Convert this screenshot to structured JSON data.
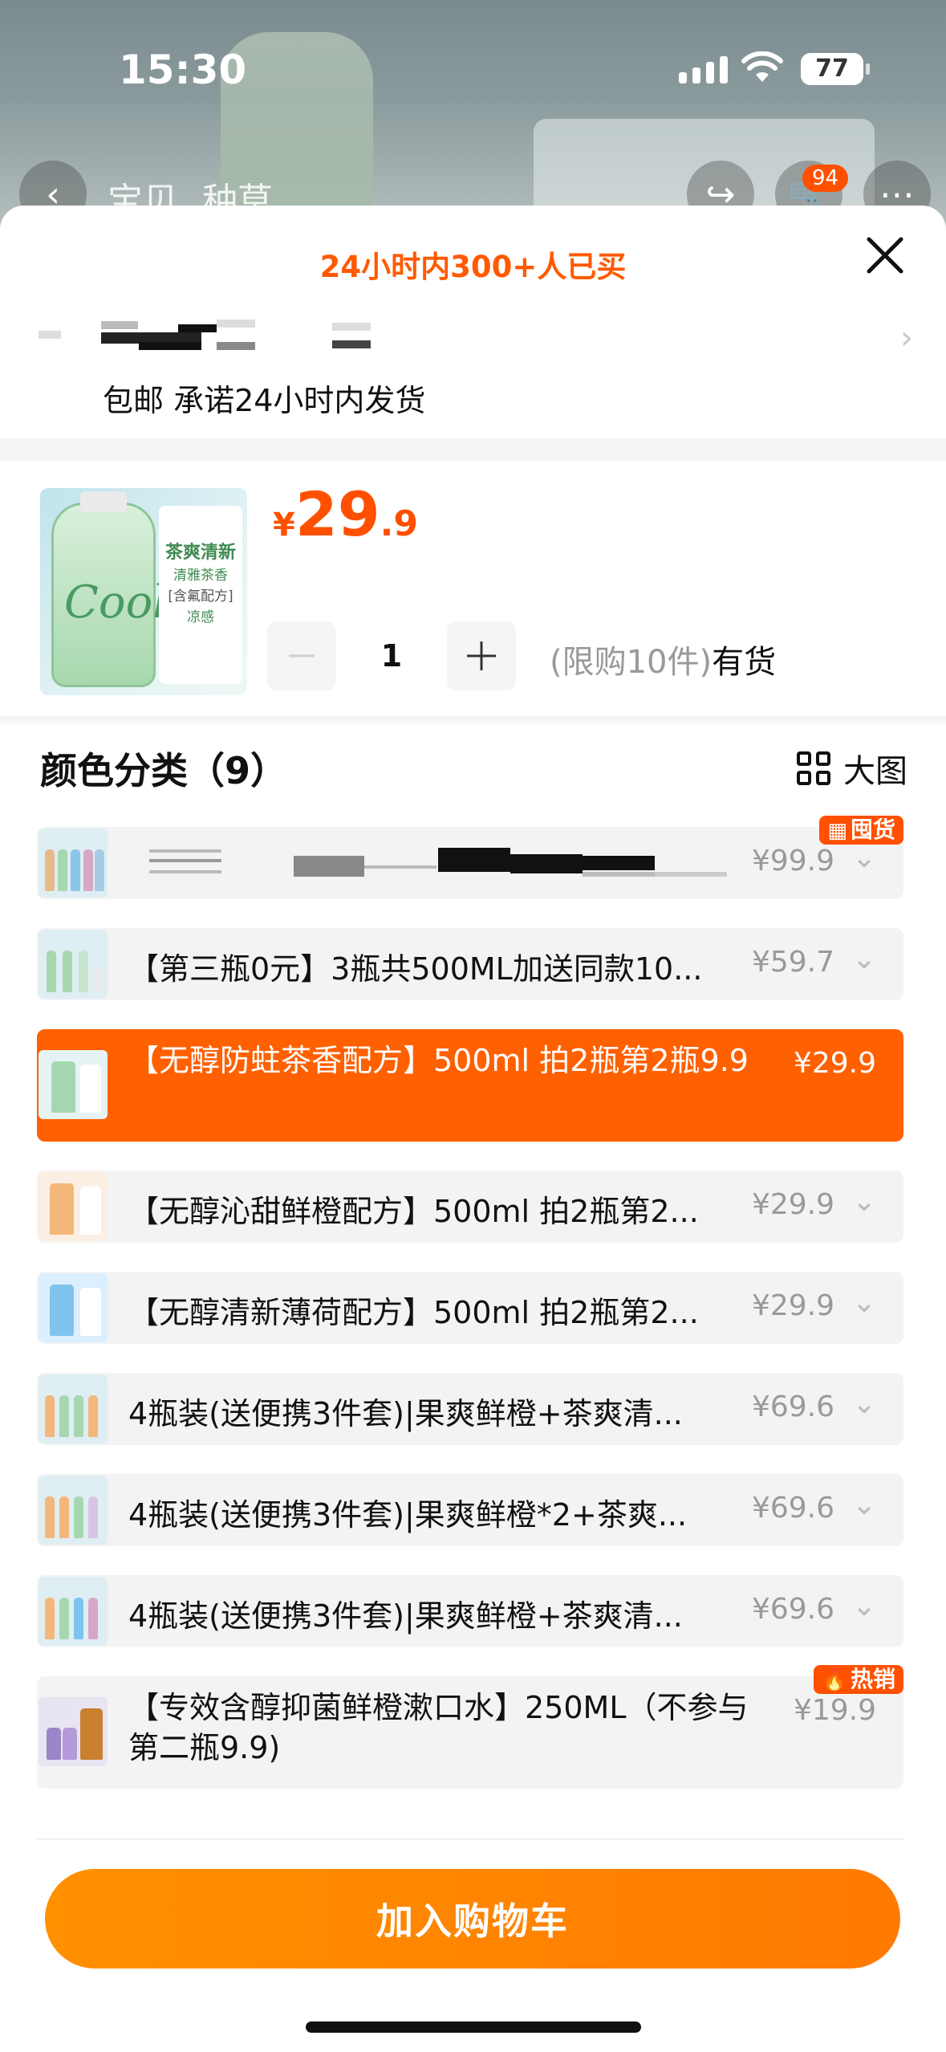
{
  "status": {
    "time": "15:30",
    "battery": "77"
  },
  "nav": {
    "tab1": "宝贝",
    "tab2": "种草",
    "cart_count": "94"
  },
  "sheet": {
    "sold_text": "24小时内300+人已买",
    "shipping": "包邮 承诺24小时内发货"
  },
  "product": {
    "currency": "¥",
    "price_int": "29",
    "price_dec": ".9",
    "quantity": "1",
    "stock_limit": "(限购10件)",
    "stock_status": "有货",
    "thumb_text_1": "茶爽清新",
    "thumb_text_2": "清雅茶香",
    "thumb_text_3": "[含氟配方]",
    "thumb_text_4": "凉感",
    "thumb_cool": "Cool"
  },
  "section": {
    "title": "颜色分类（9）",
    "big_pic": "大图"
  },
  "options": [
    {
      "label": "",
      "price": "¥99.9",
      "badge": "囤货",
      "badge_icon": "grid"
    },
    {
      "label": "【第三瓶0元】3瓶共500ML加送同款10...",
      "price": "¥59.7"
    },
    {
      "label": "【无醇防蛀茶香配方】500ml 拍2瓶第2瓶9.9",
      "price": "¥29.9",
      "selected": true
    },
    {
      "label": "【无醇沁甜鲜橙配方】500ml 拍2瓶第2...",
      "price": "¥29.9"
    },
    {
      "label": "【无醇清新薄荷配方】500ml 拍2瓶第2...",
      "price": "¥29.9"
    },
    {
      "label": "4瓶装(送便携3件套)|果爽鲜橙+茶爽清...",
      "price": "¥69.6"
    },
    {
      "label": "4瓶装(送便携3件套)|果爽鲜橙*2+茶爽...",
      "price": "¥69.6"
    },
    {
      "label": "4瓶装(送便携3件套)|果爽鲜橙+茶爽清...",
      "price": "¥69.6"
    },
    {
      "label": "【专效含醇抑菌鲜橙漱口水】250ML（不参与第二瓶9.9)",
      "price": "¥19.9",
      "badge": "热销",
      "badge_icon": "flame"
    }
  ],
  "cart_button": "加入购物车",
  "colors": {
    "accent": "#ff5000",
    "selected": "#ff6000",
    "button": "#ff8a00"
  }
}
